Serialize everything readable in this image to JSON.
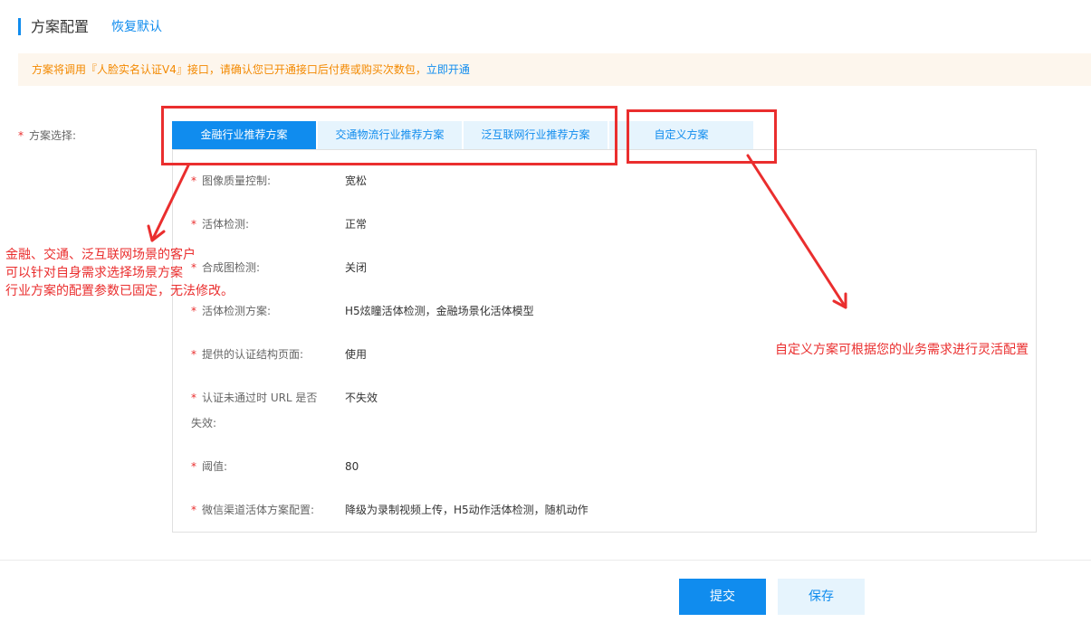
{
  "header": {
    "title": "方案配置",
    "restore_default": "恢复默认"
  },
  "notice": {
    "text": "方案将调用『人脸实名认证V4』接口，请确认您已开通接口后付费或购买次数包，",
    "link": "立即开通"
  },
  "scheme": {
    "required_mark": "*",
    "label": "方案选择:",
    "tabs": [
      {
        "label": "金融行业推荐方案",
        "active": true
      },
      {
        "label": "交通物流行业推荐方案",
        "active": false
      },
      {
        "label": "泛互联网行业推荐方案",
        "active": false
      },
      {
        "label": "自定义方案",
        "active": false
      }
    ]
  },
  "fields": [
    {
      "label": "图像质量控制:",
      "value": "宽松"
    },
    {
      "label": "活体检测:",
      "value": "正常"
    },
    {
      "label": "合成图检测:",
      "value": "关闭"
    },
    {
      "label": "活体检测方案:",
      "value": "H5炫瞳活体检测，金融场景化活体模型"
    },
    {
      "label": "提供的认证结构页面:",
      "value": "使用"
    },
    {
      "label": "认证未通过时 URL 是否失效:",
      "value": "不失效"
    },
    {
      "label": "阈值:",
      "value": "80"
    },
    {
      "label": "微信渠道活体方案配置:",
      "value": "降级为录制视频上传，H5动作活体检测，随机动作"
    }
  ],
  "footer": {
    "submit": "提交",
    "save": "保存"
  },
  "annotations": {
    "left_lines": [
      "金融、交通、泛互联网场景的客户",
      "可以针对自身需求选择场景方案",
      "行业方案的配置参数已固定，无法修改。"
    ],
    "right": "自定义方案可根据您的业务需求进行灵活配置",
    "color": "#ea2e2e"
  },
  "colors": {
    "primary": "#108cee",
    "notice_text": "#f38900",
    "notice_bg": "#fdf6ed",
    "required": "#ea2e2e"
  }
}
